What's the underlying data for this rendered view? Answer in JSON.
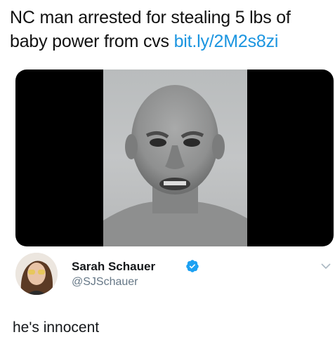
{
  "post": {
    "headline_text": "NC man arrested for stealing 5 lbs of baby power from cvs",
    "headline_link": "bit.ly/2M2s8zi"
  },
  "tweet": {
    "display_name": "Sarah Schauer",
    "handle": "@SJSchauer",
    "text": "he's innocent",
    "verified": true
  },
  "colors": {
    "link": "#1b95e0",
    "verified_badge": "#1da1f2",
    "handle": "#657786"
  },
  "icons": [
    "verified-badge-icon",
    "chevron-down-icon"
  ]
}
